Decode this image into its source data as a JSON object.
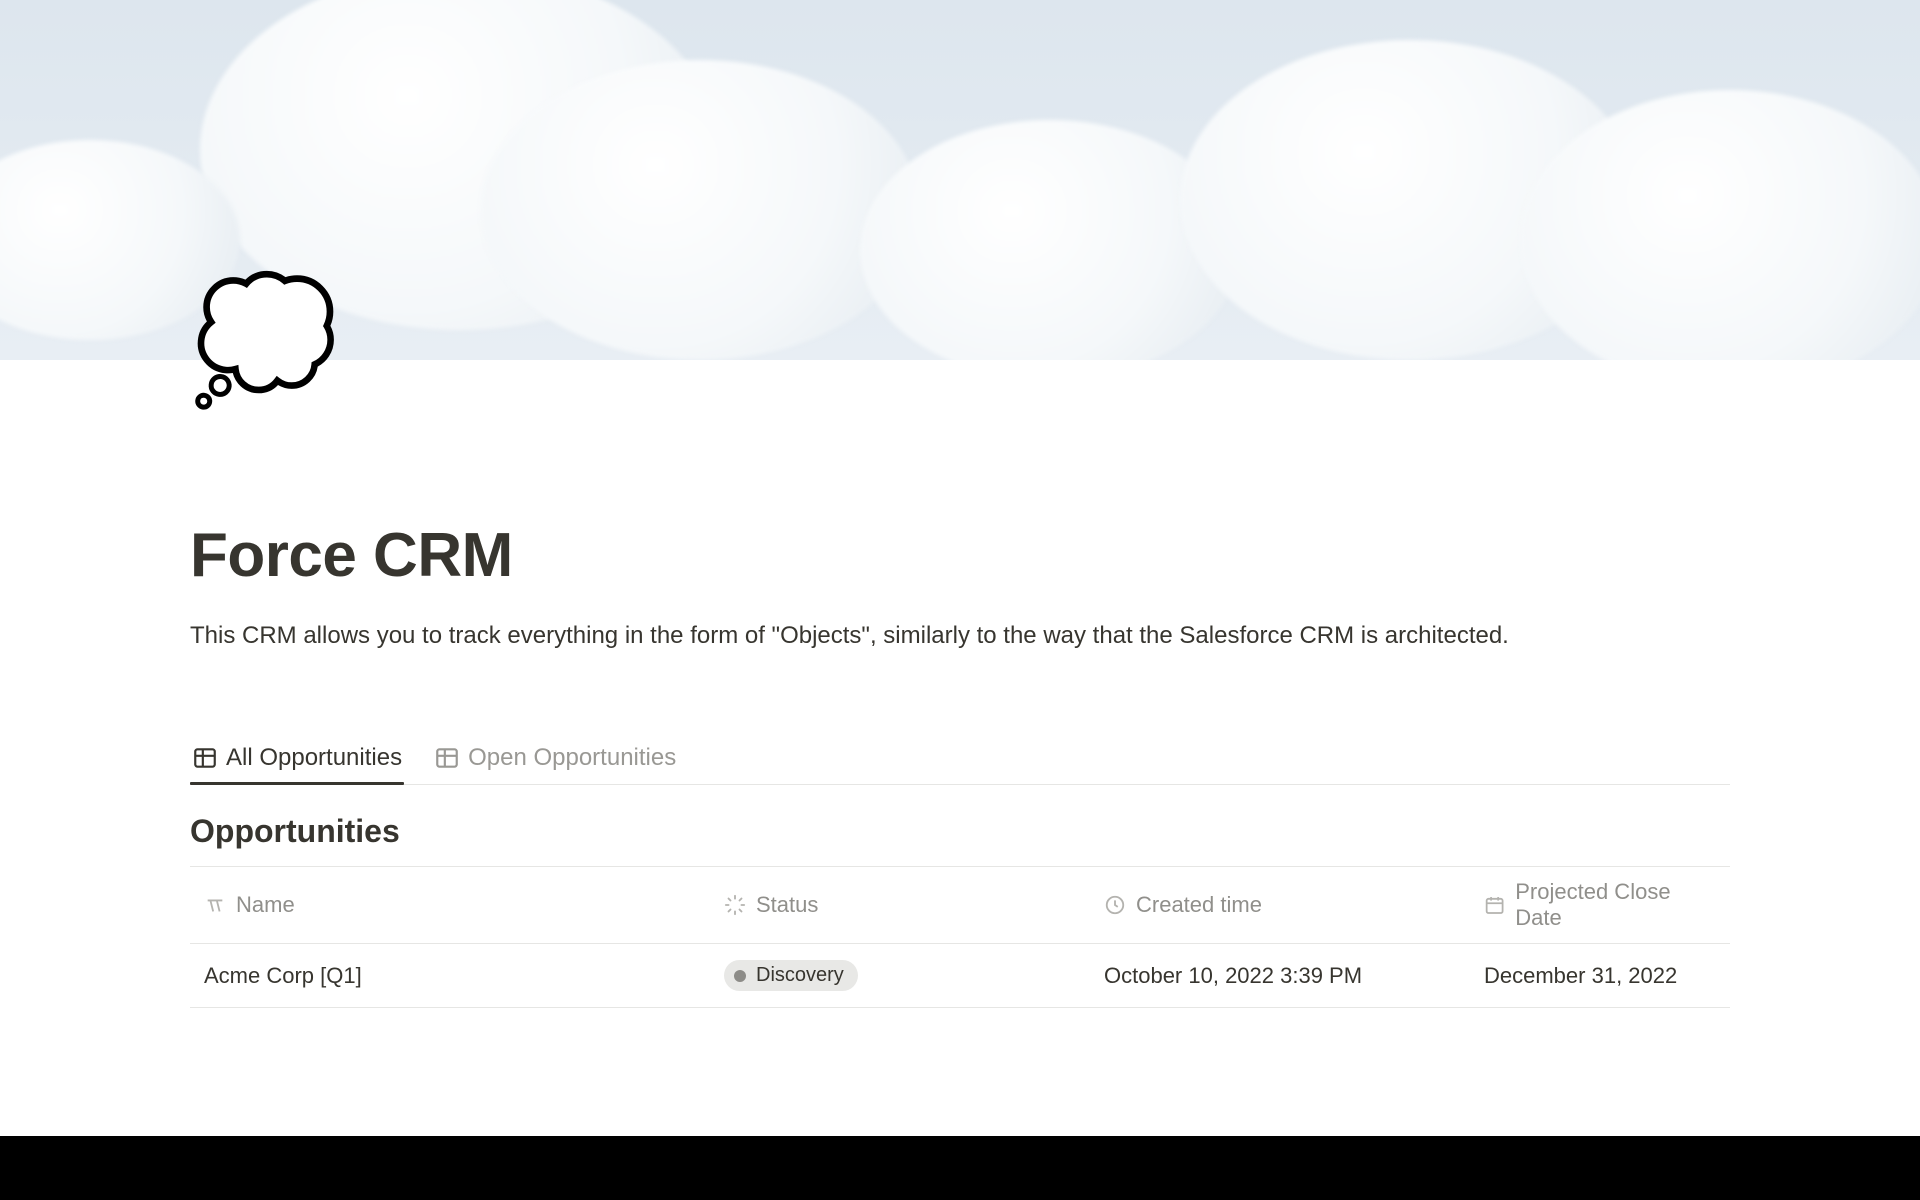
{
  "page": {
    "icon": "💭",
    "title": "Force CRM",
    "description": "This CRM allows you to track everything in the form of \"Objects\", similarly to the way that the Salesforce CRM is architected."
  },
  "tabs": [
    {
      "label": "All Opportunities",
      "active": true
    },
    {
      "label": "Open Opportunities",
      "active": false
    }
  ],
  "database": {
    "title": "Opportunities",
    "columns": [
      {
        "key": "name",
        "label": "Name",
        "icon": "title"
      },
      {
        "key": "status",
        "label": "Status",
        "icon": "status"
      },
      {
        "key": "created",
        "label": "Created time",
        "icon": "clock"
      },
      {
        "key": "close",
        "label": "Projected Close Date",
        "icon": "calendar"
      }
    ],
    "rows": [
      {
        "name": "Acme Corp [Q1]",
        "status": "Discovery",
        "created": "October 10, 2022 3:39 PM",
        "close": "December 31, 2022"
      }
    ]
  }
}
